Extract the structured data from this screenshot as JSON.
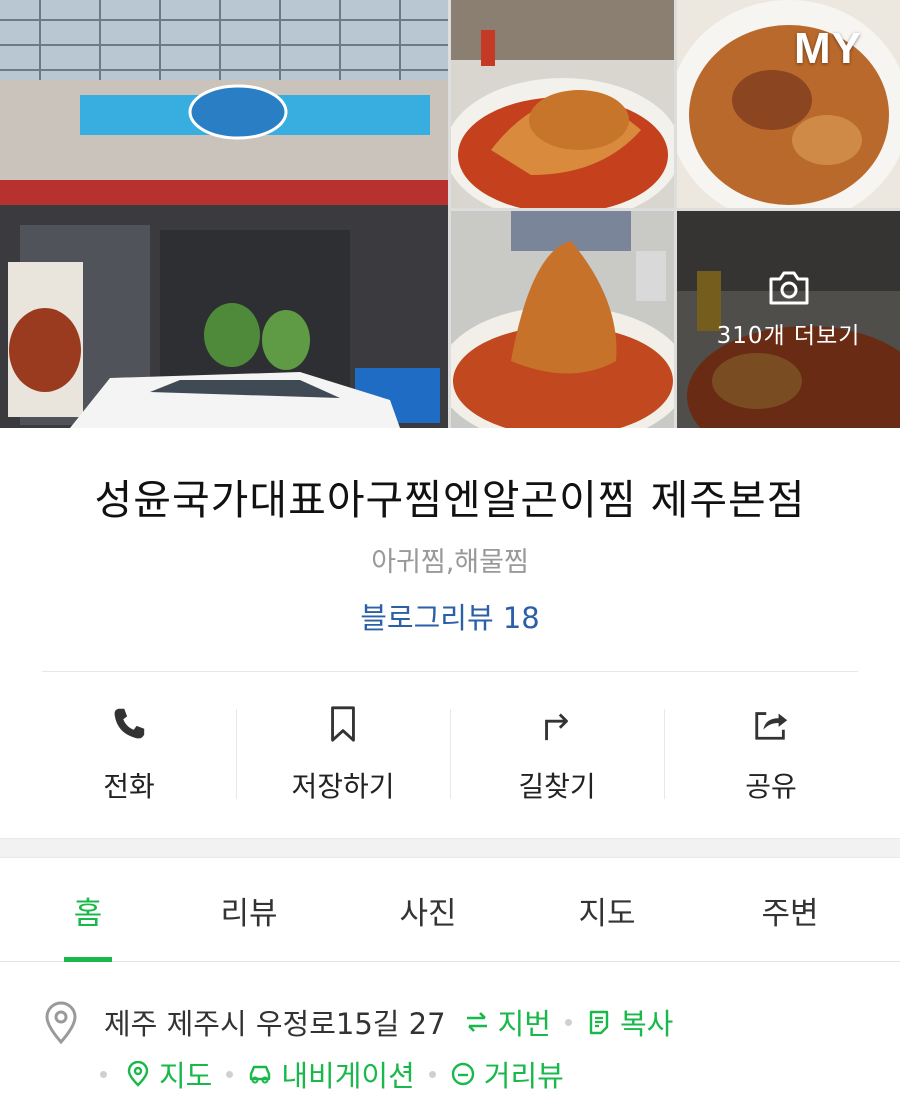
{
  "gallery": {
    "badge": "MY",
    "more_label": "310개 더보기",
    "icons": {
      "camera": "camera-icon"
    }
  },
  "place": {
    "name": "성윤국가대표아구찜엔알곤이찜 제주본점",
    "category": "아귀찜,해물찜",
    "blog_review": "블로그리뷰 18"
  },
  "actions": [
    {
      "label": "전화",
      "icon": "phone-icon"
    },
    {
      "label": "저장하기",
      "icon": "bookmark-icon"
    },
    {
      "label": "길찾기",
      "icon": "directions-icon"
    },
    {
      "label": "공유",
      "icon": "share-icon"
    }
  ],
  "tabs": [
    {
      "label": "홈",
      "active": true
    },
    {
      "label": "리뷰",
      "active": false
    },
    {
      "label": "사진",
      "active": false
    },
    {
      "label": "지도",
      "active": false
    },
    {
      "label": "주변",
      "active": false
    }
  ],
  "address": {
    "text": "제주 제주시 우정로15길 27",
    "jibun": "지번",
    "copy": "복사",
    "map": "지도",
    "navigation": "내비게이션",
    "streetview": "거리뷰"
  },
  "colors": {
    "accent_green": "#19b84a",
    "link_blue": "#2b5fa8",
    "muted_gray": "#999999"
  }
}
